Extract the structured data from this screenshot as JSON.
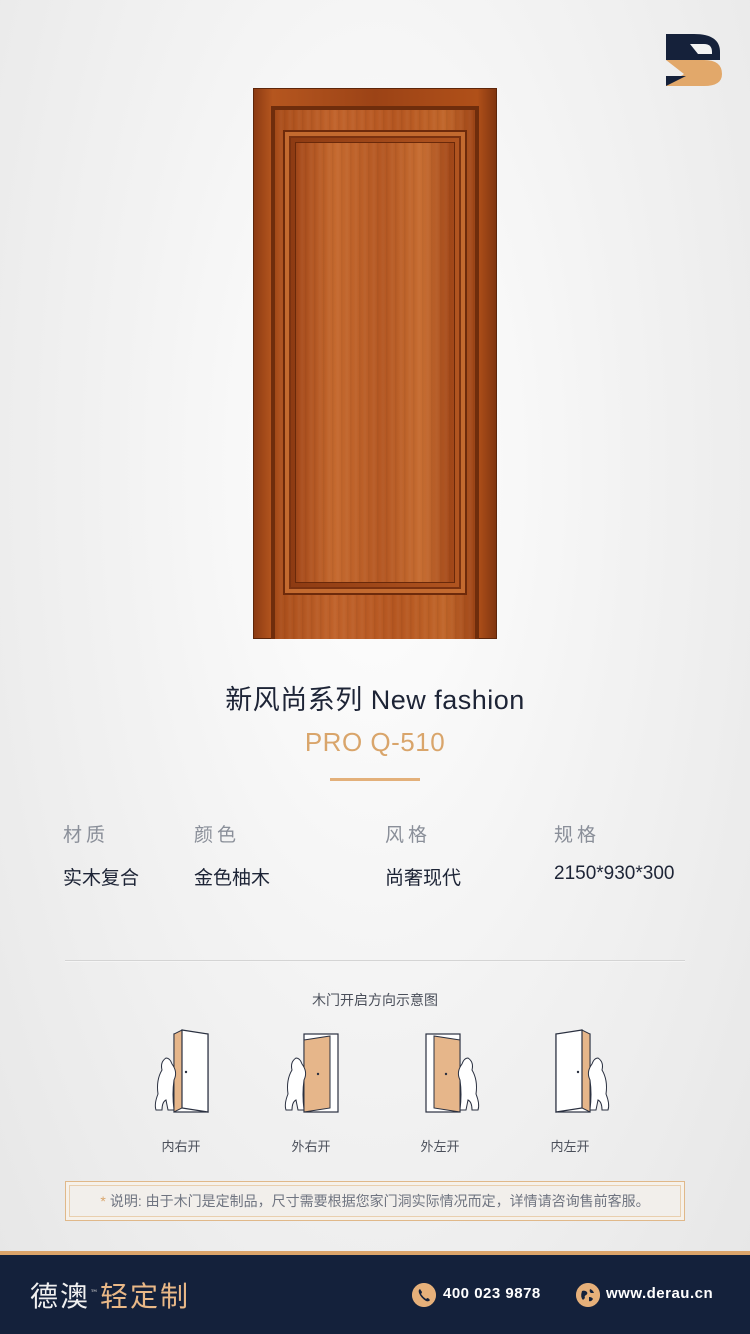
{
  "header": {
    "logo": "derau-logo"
  },
  "product": {
    "title": "新风尚系列  New fashion",
    "model": "PRO Q-510"
  },
  "specs": [
    {
      "label": "材质",
      "value": "实木复合"
    },
    {
      "label": "颜色",
      "value": "金色柚木"
    },
    {
      "label": "风格",
      "value": "尚奢现代"
    },
    {
      "label": "规格",
      "value": "2150*930*300"
    }
  ],
  "diagram": {
    "title": "木门开启方向示意图",
    "items": [
      "内右开",
      "外右开",
      "外左开",
      "内左开"
    ]
  },
  "note": {
    "marker": "*",
    "text": "说明: 由于木门是定制品，尺寸需要根据您家门洞实际情况而定，详情请咨询售前客服。"
  },
  "footer": {
    "brand": "德澳",
    "tm": "™",
    "brand_sub": "轻定制",
    "phone": "400 023 9878",
    "website": "www.derau.cn"
  },
  "colors": {
    "accent": "#d9a56b",
    "navy": "#14213b",
    "door_wood": "#b55620"
  }
}
